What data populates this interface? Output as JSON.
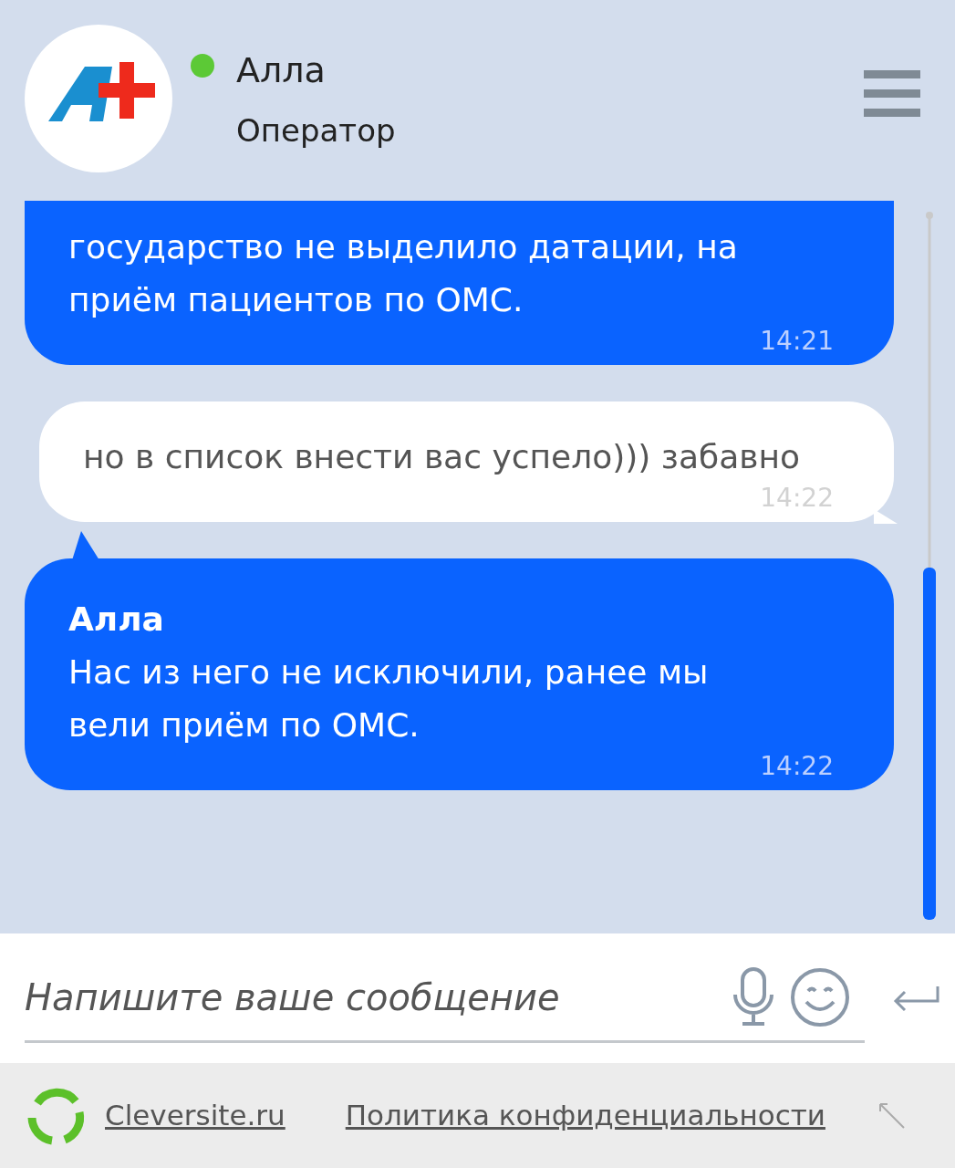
{
  "operator": {
    "name": "Алла",
    "role": "Оператор",
    "online": true
  },
  "messages": [
    {
      "kind": "operator",
      "lines": [
        "государство не выделило датации, на",
        "приём пациентов по ОМС."
      ],
      "time": "14:21"
    },
    {
      "kind": "visitor",
      "lines": [
        "но в список внести вас успело))) забавно"
      ],
      "time": "14:22"
    },
    {
      "kind": "operator",
      "author": "Алла",
      "lines": [
        "Нас из него не исключили, ранее мы",
        "вели приём по ОМС."
      ],
      "time": "14:22"
    }
  ],
  "composer": {
    "placeholder": "Напишите ваше сообщение"
  },
  "footer": {
    "links": [
      "Cleversite.ru",
      "Политика конфиденциальности"
    ]
  }
}
